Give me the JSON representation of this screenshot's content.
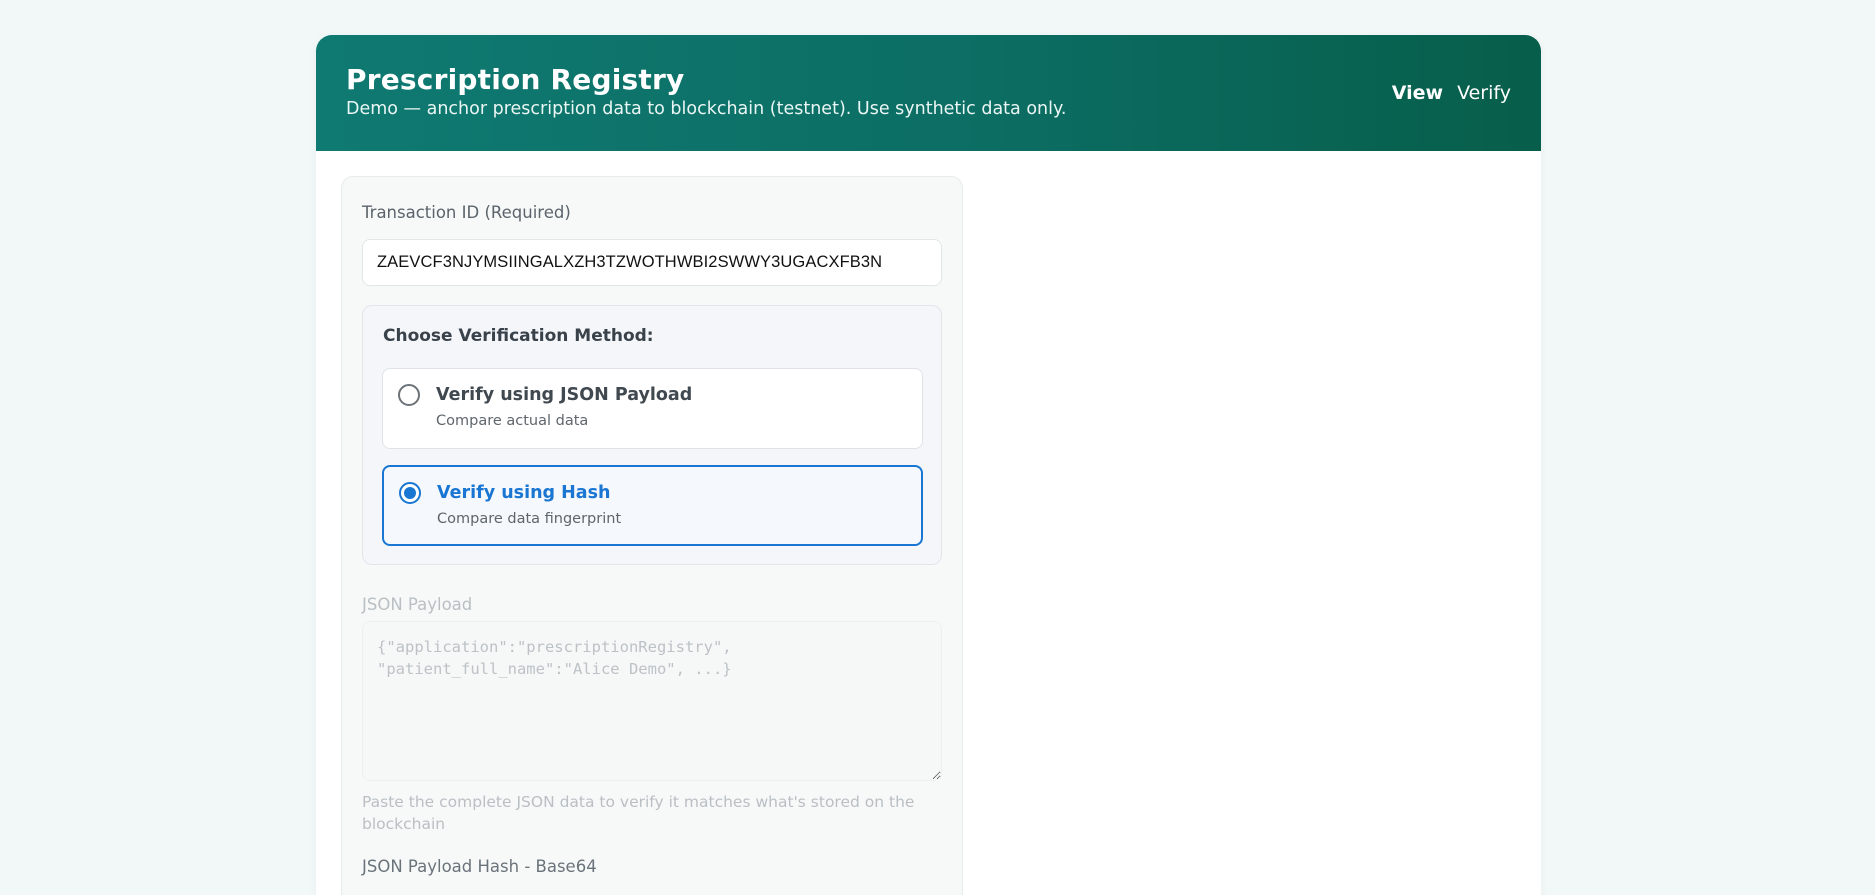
{
  "header": {
    "title": "Prescription Registry",
    "subtitle": "Demo — anchor prescription data to blockchain (testnet). Use synthetic data only.",
    "nav": [
      {
        "label": "View",
        "active": true
      },
      {
        "label": "Verify",
        "active": false
      }
    ]
  },
  "form": {
    "tx_label": "Transaction ID (Required)",
    "tx_value": "ZAEVCF3NJYMSIINGALXZH3TZWOTHWBI2SWWY3UGACXFB3N",
    "method": {
      "title": "Choose Verification Method:",
      "options": [
        {
          "title": "Verify using JSON Payload",
          "desc": "Compare actual data",
          "selected": false
        },
        {
          "title": "Verify using Hash",
          "desc": "Compare data fingerprint",
          "selected": true
        }
      ]
    },
    "payload_label": "JSON Payload",
    "payload_placeholder": "{\"application\":\"prescriptionRegistry\",\n\"patient_full_name\":\"Alice Demo\", ...}",
    "payload_help": "Paste the complete JSON data to verify it matches what's stored on the blockchain",
    "next_label": "JSON Payload Hash - Base64"
  },
  "colors": {
    "accent": "#1976d2",
    "header_start": "#0f7a72",
    "header_end": "#075e4a"
  }
}
